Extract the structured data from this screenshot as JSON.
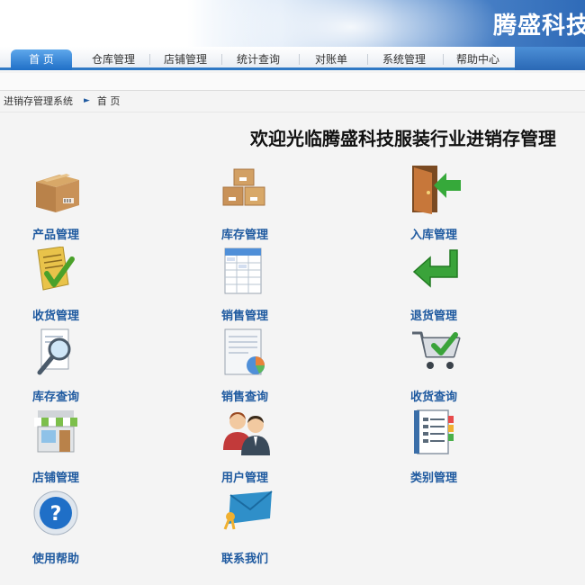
{
  "header": {
    "brand": "腾盛科技"
  },
  "nav": {
    "tabs": [
      {
        "label": "首 页",
        "active": true
      },
      {
        "label": "仓库管理",
        "active": false
      },
      {
        "label": "店铺管理",
        "active": false
      },
      {
        "label": "统计查询",
        "active": false
      },
      {
        "label": "对账单",
        "active": false
      },
      {
        "label": "系统管理",
        "active": false
      },
      {
        "label": "帮助中心",
        "active": false
      }
    ]
  },
  "breadcrumb": {
    "root": "进销存管理系统",
    "current": "首 页"
  },
  "page": {
    "title": "欢迎光临腾盛科技服装行业进销存管理"
  },
  "modules": [
    {
      "label": "产品管理",
      "icon": "product-box-icon"
    },
    {
      "label": "库存管理",
      "icon": "stock-boxes-icon"
    },
    {
      "label": "入库管理",
      "icon": "door-enter-icon"
    },
    {
      "label": "收货管理",
      "icon": "document-check-icon"
    },
    {
      "label": "销售管理",
      "icon": "spreadsheet-icon"
    },
    {
      "label": "退货管理",
      "icon": "return-arrow-icon"
    },
    {
      "label": "库存查询",
      "icon": "magnifier-document-icon"
    },
    {
      "label": "销售查询",
      "icon": "report-chart-icon"
    },
    {
      "label": "收货查询",
      "icon": "cart-check-icon"
    },
    {
      "label": "店铺管理",
      "icon": "shop-awning-icon"
    },
    {
      "label": "用户管理",
      "icon": "users-icon"
    },
    {
      "label": "类别管理",
      "icon": "notebook-icon"
    },
    {
      "label": "使用帮助",
      "icon": "help-question-icon"
    },
    {
      "label": "联系我们",
      "icon": "envelope-icon"
    }
  ],
  "colors": {
    "accent": "#2f79c5",
    "link": "#1f5aa0"
  }
}
